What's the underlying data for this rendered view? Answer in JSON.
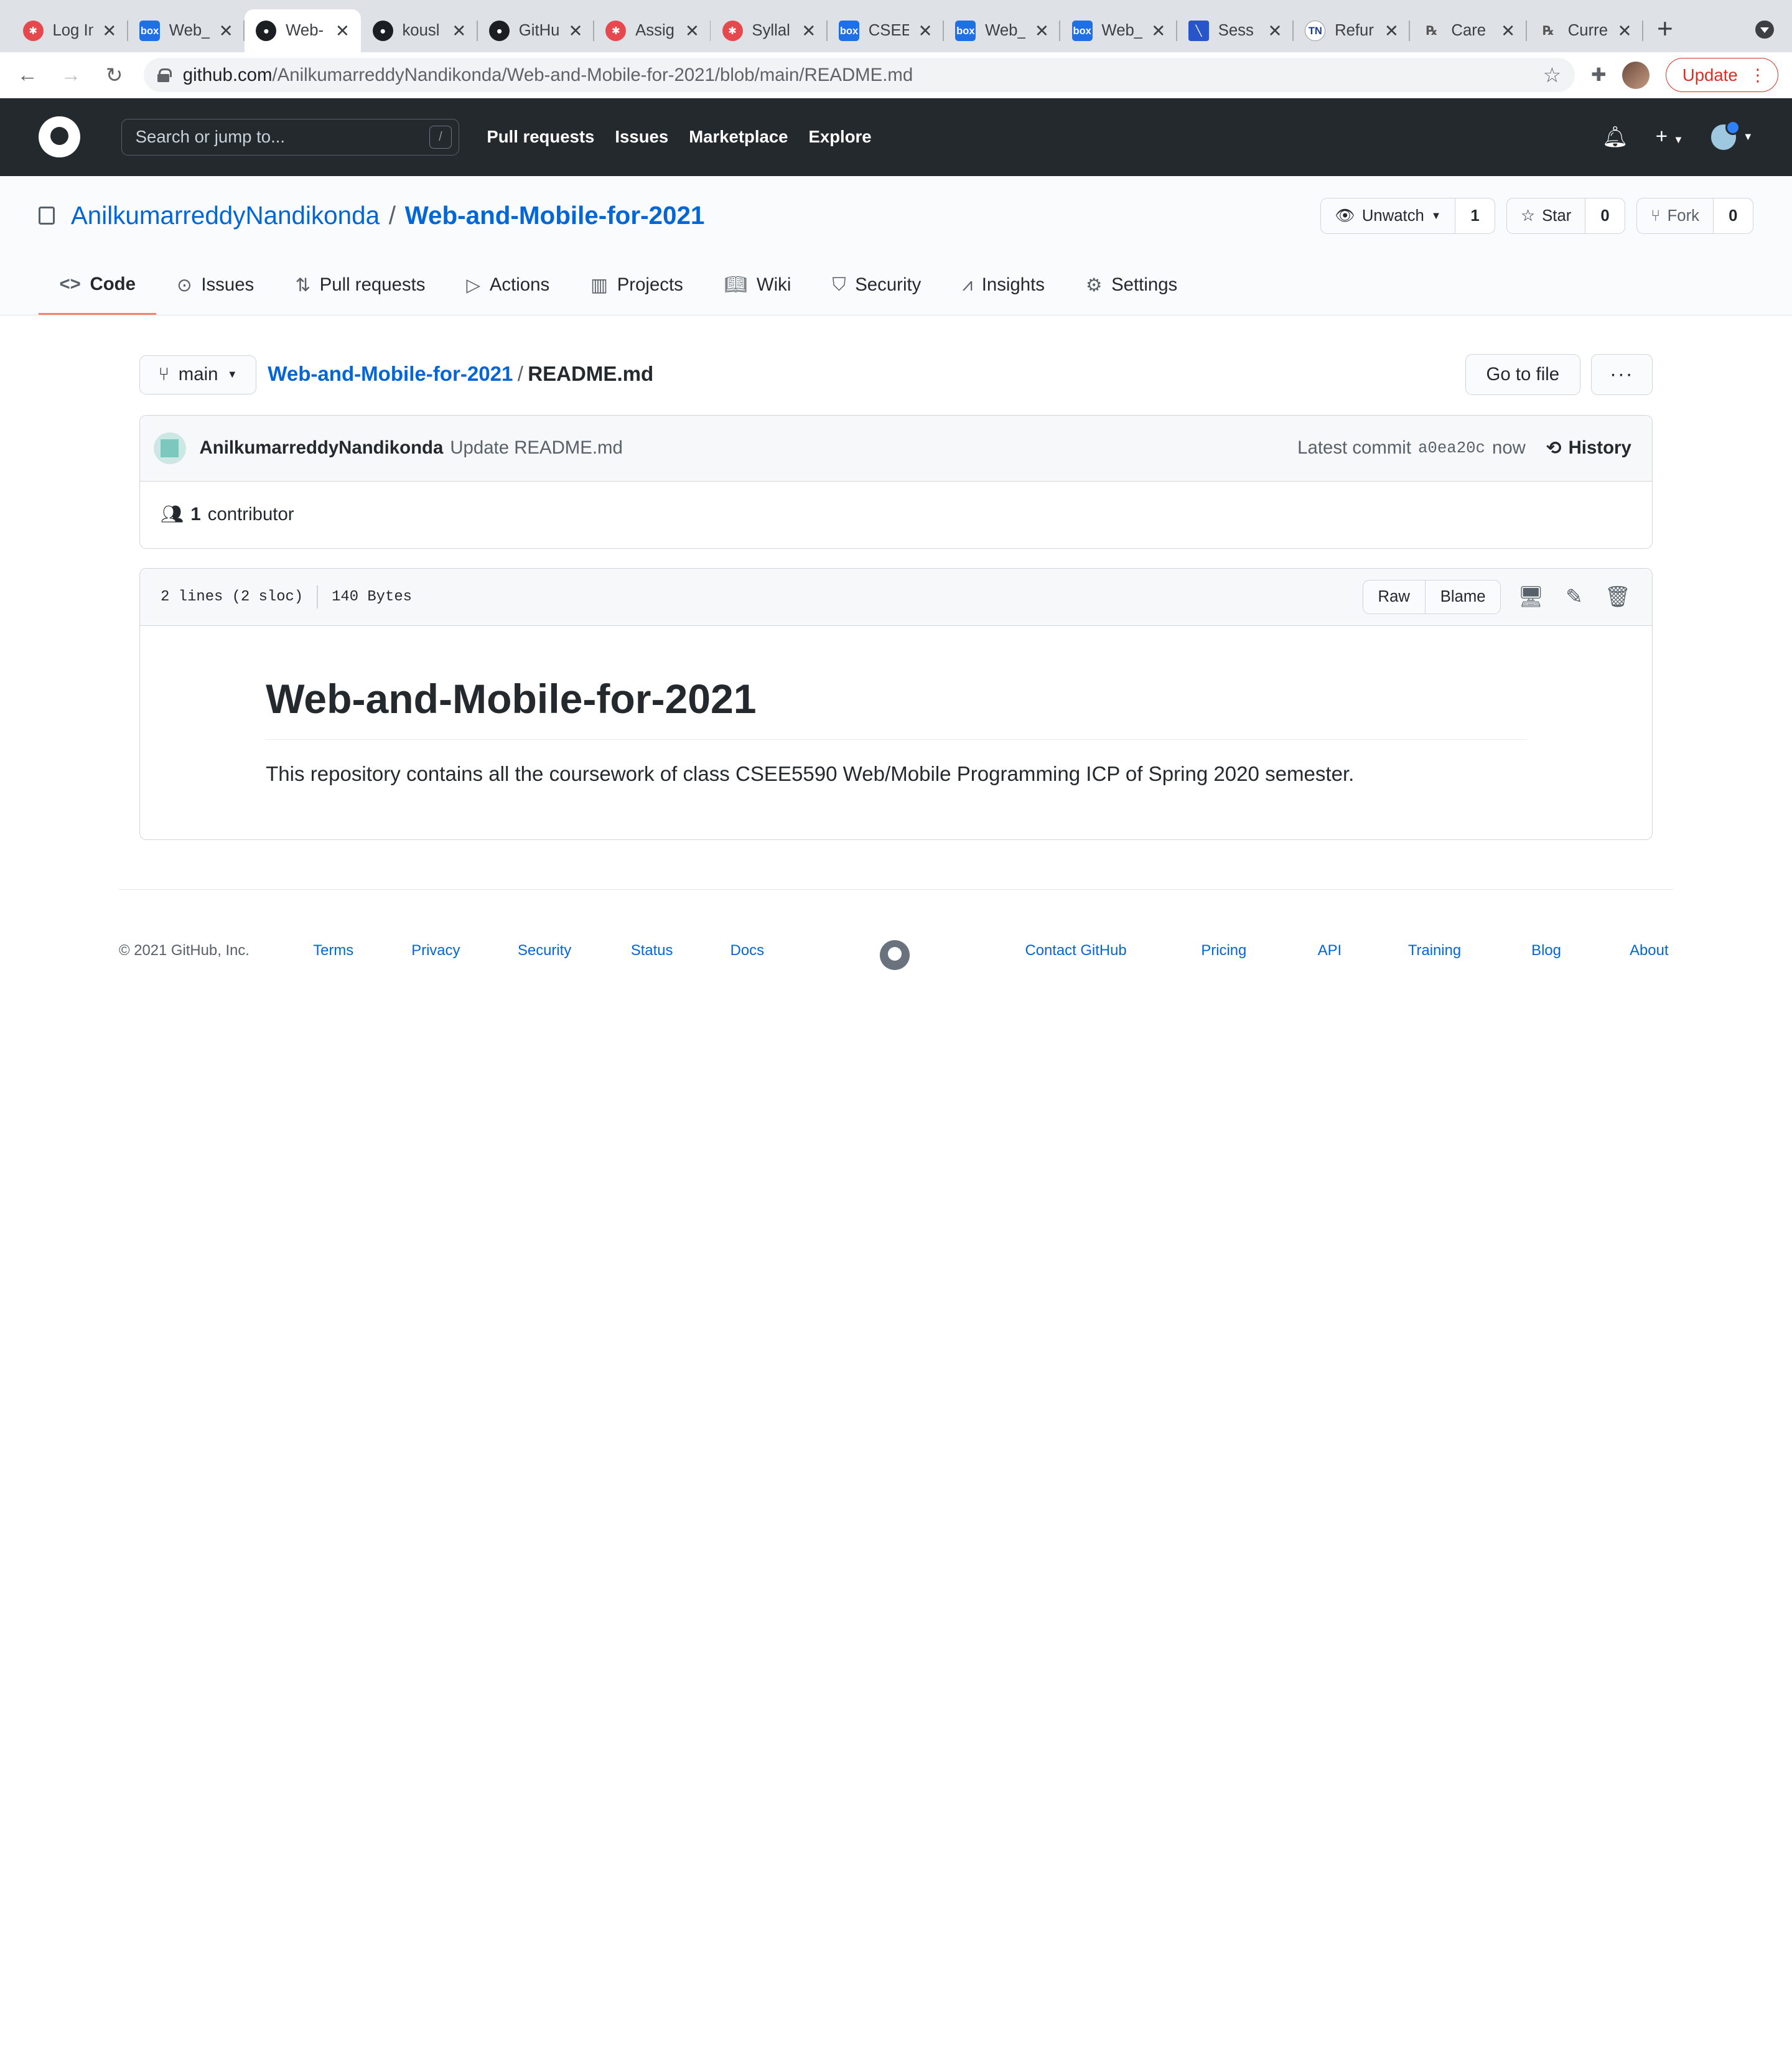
{
  "browser": {
    "tabs": [
      {
        "title": "Log In",
        "icon": "canvas-icon"
      },
      {
        "title": "Web_",
        "icon": "box-icon"
      },
      {
        "title": "Web-",
        "icon": "github-icon",
        "active": true
      },
      {
        "title": "kousl",
        "icon": "github-icon"
      },
      {
        "title": "GitHu",
        "icon": "github-icon"
      },
      {
        "title": "Assig",
        "icon": "canvas-icon"
      },
      {
        "title": "Syllal",
        "icon": "canvas-icon"
      },
      {
        "title": "CSEE",
        "icon": "box-icon"
      },
      {
        "title": "Web_",
        "icon": "box-icon"
      },
      {
        "title": "Web_",
        "icon": "box-icon"
      },
      {
        "title": "Sess",
        "icon": "session-icon"
      },
      {
        "title": "Refur",
        "icon": "refund-icon"
      },
      {
        "title": "Care",
        "icon": "rx-icon"
      },
      {
        "title": "Curre",
        "icon": "rx-icon"
      }
    ],
    "url_host": "github.com",
    "url_path": "/AnilkumarreddyNandikonda/Web-and-Mobile-for-2021/blob/main/README.md",
    "update_label": "Update"
  },
  "header": {
    "search_placeholder": "Search or jump to...",
    "search_key": "/",
    "nav": [
      "Pull requests",
      "Issues",
      "Marketplace",
      "Explore"
    ]
  },
  "repo": {
    "owner": "AnilkumarreddyNandikonda",
    "name": "Web-and-Mobile-for-2021",
    "unwatch_label": "Unwatch",
    "watch_count": "1",
    "star_label": "Star",
    "star_count": "0",
    "fork_label": "Fork",
    "fork_count": "0",
    "tabs": [
      "Code",
      "Issues",
      "Pull requests",
      "Actions",
      "Projects",
      "Wiki",
      "Security",
      "Insights",
      "Settings"
    ]
  },
  "file": {
    "branch": "main",
    "repo_crumb": "Web-and-Mobile-for-2021",
    "filename": "README.md",
    "goto_label": "Go to file",
    "more_label": "···",
    "commit_author": "AnilkumarreddyNandikonda",
    "commit_message": "Update README.md",
    "latest_commit_label": "Latest commit",
    "commit_sha": "a0ea20c",
    "commit_time": "now",
    "history_label": "History",
    "contributors_count": "1",
    "contributors_label": "contributor",
    "lines_info": "2 lines (2 sloc)",
    "size_info": "140 Bytes",
    "raw_label": "Raw",
    "blame_label": "Blame",
    "readme_title": "Web-and-Mobile-for-2021",
    "readme_body": "This repository contains all the coursework of class CSEE5590 Web/Mobile Programming ICP of Spring 2020 semester."
  },
  "footer": {
    "copyright": "© 2021 GitHub, Inc.",
    "left_links": [
      "Terms",
      "Privacy",
      "Security",
      "Status",
      "Docs"
    ],
    "right_links": [
      "Contact GitHub",
      "Pricing",
      "API",
      "Training",
      "Blog",
      "About"
    ]
  }
}
